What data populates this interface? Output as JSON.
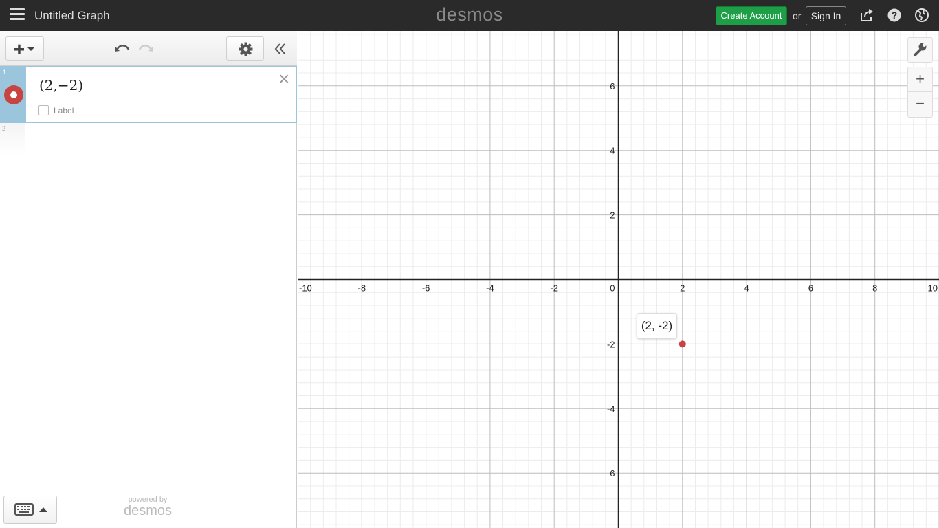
{
  "header": {
    "title": "Untitled Graph",
    "brand": "desmos",
    "create_account": "Create Account",
    "or": "or",
    "sign_in": "Sign In",
    "icons": [
      "share-icon",
      "help-icon",
      "globe-icon"
    ]
  },
  "toolbar": {
    "icons": [
      "plus-icon",
      "undo-icon",
      "redo-icon",
      "gear-icon",
      "collapse-icon"
    ]
  },
  "expressions": [
    {
      "index": "1",
      "latex": "(2,−2)",
      "label_checkbox": "Label",
      "color": "#c74440"
    },
    {
      "index": "2"
    }
  ],
  "powered_by": {
    "small": "powered by",
    "big": "desmos"
  },
  "graph": {
    "x_ticks": [
      "-10",
      "-8",
      "-6",
      "-4",
      "-2",
      "0",
      "2",
      "4",
      "6",
      "8",
      "10"
    ],
    "y_ticks": [
      "6",
      "4",
      "2",
      "-2",
      "-4",
      "-6"
    ],
    "point_label": "(2, -2)",
    "point": {
      "x": 2,
      "y": -2
    },
    "point_color": "#c74440",
    "x_range": [
      -10,
      10
    ],
    "y_range": [
      -7.7,
      7.7
    ]
  },
  "graph_controls": [
    "wrench-icon",
    "zoom-in-icon",
    "zoom-out-icon"
  ]
}
